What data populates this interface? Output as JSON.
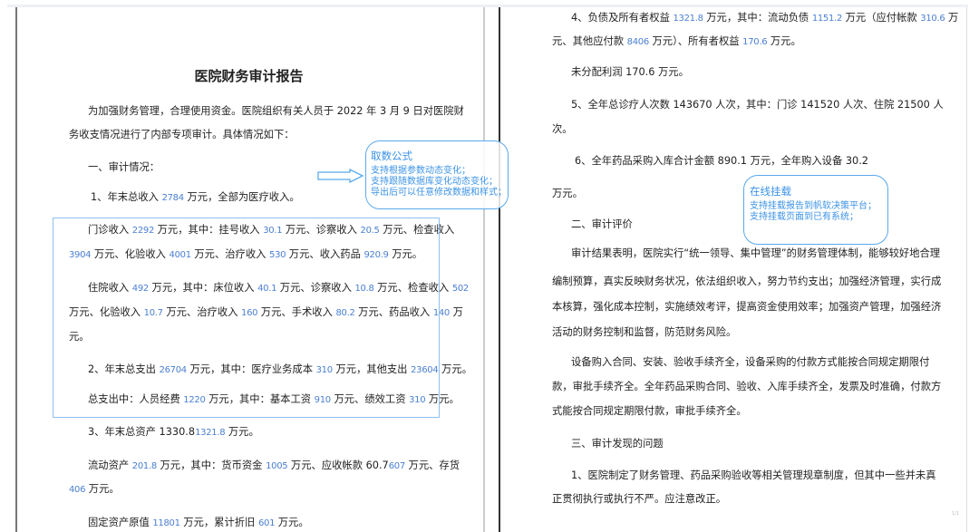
{
  "left_page": {
    "lines": [
      {
        "style": "title",
        "segs": [
          {
            "t": "医院财务审计报告"
          }
        ]
      },
      {
        "style": "indent",
        "segs": [
          {
            "t": "为加强财务管理，合理使用资金。医院组织有关人员于 2022 年 3 月 9 日对医院财"
          }
        ]
      },
      {
        "style": "plain",
        "segs": [
          {
            "t": "务收支情况进行了内部专项审计。具体情况如下："
          }
        ]
      },
      {
        "style": "indent",
        "segs": [
          {
            "t": "一、审计情况："
          }
        ]
      },
      {
        "style": "indent2",
        "segs": [
          {
            "t": "1、年末总收入 "
          },
          {
            "t": "2784",
            "hl": true
          },
          {
            "t": " 万元，全部为医疗收入。"
          }
        ]
      },
      {
        "style": "indent",
        "segs": [
          {
            "t": "门诊收入 "
          },
          {
            "t": "2292",
            "hl": true
          },
          {
            "t": " 万元，其中：挂号收入 "
          },
          {
            "t": "30.1",
            "hl": true
          },
          {
            "t": " 万元、诊察收入 "
          },
          {
            "t": "20.5",
            "hl": true
          },
          {
            "t": " 万元、检查收入"
          }
        ]
      },
      {
        "style": "plain",
        "segs": [
          {
            "t": "3904",
            "hl": true
          },
          {
            "t": " 万元、化验收入 "
          },
          {
            "t": "4001",
            "hl": true
          },
          {
            "t": " 万元、治疗收入 "
          },
          {
            "t": "530",
            "hl": true
          },
          {
            "t": " 万元、收入药品 "
          },
          {
            "t": "920.9",
            "hl": true
          },
          {
            "t": " 万元。"
          }
        ]
      },
      {
        "style": "indent",
        "segs": [
          {
            "t": "住院收入 "
          },
          {
            "t": "492",
            "hl": true
          },
          {
            "t": " 万元，其中：床位收入 "
          },
          {
            "t": "40.1",
            "hl": true
          },
          {
            "t": " 万元、诊察收入 "
          },
          {
            "t": "10.8",
            "hl": true
          },
          {
            "t": " 万元、检查收入 "
          },
          {
            "t": "502",
            "hl": true
          }
        ]
      },
      {
        "style": "plain",
        "segs": [
          {
            "t": "万元、化验收入 "
          },
          {
            "t": "10.7",
            "hl": true
          },
          {
            "t": " 万元、治疗收入 "
          },
          {
            "t": "160",
            "hl": true
          },
          {
            "t": " 万元、手术收入 "
          },
          {
            "t": "80.2",
            "hl": true
          },
          {
            "t": " 万元、药品收入 "
          },
          {
            "t": "140",
            "hl": true
          },
          {
            "t": " 万"
          }
        ]
      },
      {
        "style": "plain",
        "segs": [
          {
            "t": "元。"
          }
        ]
      },
      {
        "style": "indent",
        "segs": [
          {
            "t": "2、年末总支出 "
          },
          {
            "t": "26704",
            "hl": true
          },
          {
            "t": " 万元，其中：医疗业务成本 "
          },
          {
            "t": "310",
            "hl": true
          },
          {
            "t": " 万元，其他支出 "
          },
          {
            "t": "23604",
            "hl": true
          },
          {
            "t": " 万元。"
          }
        ]
      },
      {
        "style": "indent",
        "segs": [
          {
            "t": "总支出中：人员经费 "
          },
          {
            "t": "1220",
            "hl": true
          },
          {
            "t": " 万元，其中：基本工资 "
          },
          {
            "t": "910",
            "hl": true
          },
          {
            "t": " 万元、绩效工资 "
          },
          {
            "t": "310",
            "hl": true
          },
          {
            "t": " 万元。"
          }
        ]
      },
      {
        "style": "indent",
        "segs": [
          {
            "t": "3、年末总资产 1330.8"
          },
          {
            "t": "1321.8",
            "hl": true
          },
          {
            "t": " 万元。"
          }
        ]
      },
      {
        "style": "indent",
        "segs": [
          {
            "t": "流动资产 "
          },
          {
            "t": "201.8",
            "hl": true
          },
          {
            "t": " 万元，其中：货币资金 "
          },
          {
            "t": "1005",
            "hl": true
          },
          {
            "t": " 万元、应收帐款 60.7"
          },
          {
            "t": "607",
            "hl": true
          },
          {
            "t": " 万元、存货"
          }
        ]
      },
      {
        "style": "plain",
        "segs": [
          {
            "t": "406",
            "hl": true
          },
          {
            "t": " 万元。"
          }
        ]
      },
      {
        "style": "indent",
        "segs": [
          {
            "t": "固定资产原值 "
          },
          {
            "t": "11801",
            "hl": true
          },
          {
            "t": " 万元，累计折旧 "
          },
          {
            "t": "601",
            "hl": true
          },
          {
            "t": " 万元。"
          }
        ]
      }
    ]
  },
  "right_page": {
    "lines": [
      {
        "style": "indent",
        "segs": [
          {
            "t": "4、负债及所有者权益 "
          },
          {
            "t": "1321.8",
            "hl": true
          },
          {
            "t": " 万元，其中：流动负债 "
          },
          {
            "t": "1151.2",
            "hl": true
          },
          {
            "t": " 万元（应付帐款 "
          },
          {
            "t": "310.6",
            "hl": true
          },
          {
            "t": " 万"
          }
        ]
      },
      {
        "style": "plain",
        "segs": [
          {
            "t": "元、其他应付款 "
          },
          {
            "t": "8406",
            "hl": true
          },
          {
            "t": " 万元）、所有者权益 "
          },
          {
            "t": "170.6",
            "hl": true
          },
          {
            "t": " 万元。"
          }
        ]
      },
      {
        "style": "indent",
        "segs": [
          {
            "t": "未分配利润 170.6 万元。"
          }
        ]
      },
      {
        "style": "indent",
        "segs": [
          {
            "t": "5、全年总诊疗人次数 143670 人次，其中：门诊 141520 人次、住院 21500 人"
          }
        ]
      },
      {
        "style": "plain",
        "segs": [
          {
            "t": "次。"
          }
        ]
      },
      {
        "style": "indent2",
        "segs": [
          {
            "t": "6、全年药品采购入库合计金额 890.1 万元，全年购入设备 30.2"
          }
        ]
      },
      {
        "style": "plain",
        "segs": [
          {
            "t": "万元。"
          }
        ]
      },
      {
        "style": "indent",
        "segs": [
          {
            "t": "二、审计评价"
          }
        ]
      },
      {
        "style": "indent",
        "segs": [
          {
            "t": "审计结果表明，医院实行“统一领导、集中管理”的财务管理体制，能够较好地合理"
          }
        ]
      },
      {
        "style": "plain",
        "segs": [
          {
            "t": "编制预算，真实反映财务状况，依法组织收入，努力节约支出；加强经济管理，实行成"
          }
        ]
      },
      {
        "style": "plain",
        "segs": [
          {
            "t": "本核算，强化成本控制，实施绩效考评，提高资金使用效率；加强资产管理，加强经济"
          }
        ]
      },
      {
        "style": "plain",
        "segs": [
          {
            "t": "活动的财务控制和监督，防范财务风险。"
          }
        ]
      },
      {
        "style": "indent",
        "segs": [
          {
            "t": "设备购入合同、安装、验收手续齐全，设备采购的付款方式能按合同规定期限付"
          }
        ]
      },
      {
        "style": "plain",
        "segs": [
          {
            "t": "款，审批手续齐全。全年药品采购合同、验收、入库手续齐全，发票及时准确，付款方"
          }
        ]
      },
      {
        "style": "plain",
        "segs": [
          {
            "t": "式能按合同规定期限付款，审批手续齐全。"
          }
        ]
      },
      {
        "style": "indent",
        "segs": [
          {
            "t": "三、审计发现的问题"
          }
        ]
      },
      {
        "style": "indent",
        "segs": [
          {
            "t": "1、医院制定了财务管理、药品采购验收等相关管理规章制度，但其中一些并未真"
          }
        ]
      },
      {
        "style": "plain",
        "segs": [
          {
            "t": "正贯彻执行或执行不严。应注意改正。"
          }
        ]
      }
    ]
  },
  "callouts": {
    "formula": {
      "title": "取数公式",
      "items": [
        "支持根据参数动态变化；",
        "支持跟随数据库变化动态变化；",
        "导出后可以任意修改数据和样式；"
      ]
    },
    "mount": {
      "title": "在线挂载",
      "items": [
        "支持挂载报告到帆软决策平台；",
        "支持挂载页面到已有系统；"
      ]
    }
  },
  "page_indicator": "1/1",
  "colors": {
    "highlight": "#4a7fd1",
    "callout": "#3c93e6",
    "box": "#8ec0f0"
  }
}
